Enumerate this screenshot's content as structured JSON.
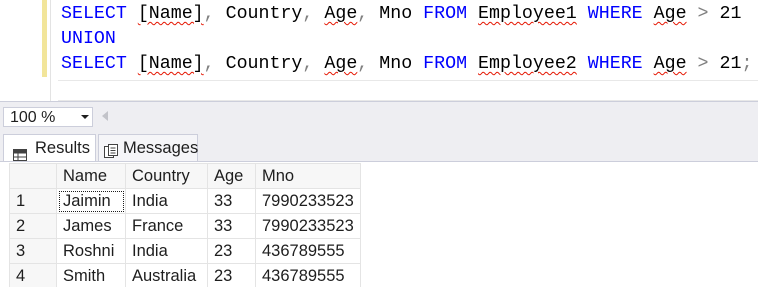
{
  "editor": {
    "line1": {
      "kw1": "SELECT",
      "col1": "[Name]",
      "sep1": ",",
      "col2": "Country",
      "sep2": ",",
      "col3": "Age",
      "sep3": ",",
      "col4": "Mno",
      "kw2": "FROM",
      "table": "Employee1",
      "kw3": "WHERE",
      "cond_col": "Age",
      "op": ">",
      "value": "21"
    },
    "line2": {
      "kw": "UNION"
    },
    "line3": {
      "kw1": "SELECT",
      "col1": "[Name]",
      "sep1": ",",
      "col2": "Country",
      "sep2": ",",
      "col3": "Age",
      "sep3": ",",
      "col4": "Mno",
      "kw2": "FROM",
      "table": "Employee2",
      "kw3": "WHERE",
      "cond_col": "Age",
      "op": ">",
      "value": "21",
      "terminator": ";"
    }
  },
  "zoom": {
    "value": "100 %"
  },
  "tabs": {
    "results": {
      "label": "Results",
      "icon": "grid-icon"
    },
    "messages": {
      "label": "Messages",
      "icon": "messages-icon"
    }
  },
  "grid": {
    "columns": [
      "",
      "Name",
      "Country",
      "Age",
      "Mno"
    ],
    "rows": [
      [
        "1",
        "Jaimin",
        "India",
        "33",
        "7990233523"
      ],
      [
        "2",
        "James",
        "France",
        "33",
        "7990233523"
      ],
      [
        "3",
        "Roshni",
        "India",
        "23",
        "436789555"
      ],
      [
        "4",
        "Smith",
        "Australia",
        "23",
        "436789555"
      ]
    ]
  },
  "colors": {
    "keyword": "#0000ff",
    "operator": "#808080",
    "squiggle": "#e51400",
    "chrome": "#eeeef2"
  }
}
